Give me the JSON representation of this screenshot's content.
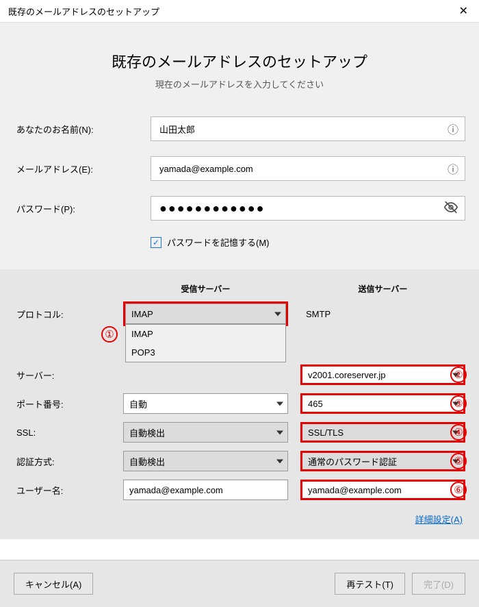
{
  "window": {
    "title": "既存のメールアドレスのセットアップ"
  },
  "header": {
    "heading": "既存のメールアドレスのセットアップ",
    "subheading": "現在のメールアドレスを入力してください"
  },
  "form": {
    "name_label": "あなたのお名前(N):",
    "name_value": "山田太郎",
    "email_label": "メールアドレス(E):",
    "email_value": "yamada@example.com",
    "password_label": "パスワード(P):",
    "password_mask": "●●●●●●●●●●●●",
    "remember_label": "パスワードを記憶する(M)"
  },
  "servers": {
    "incoming_header": "受信サーバー",
    "outgoing_header": "送信サーバー",
    "rows": {
      "protocol": {
        "label": "プロトコル:",
        "in": "IMAP",
        "out": "SMTP",
        "options": [
          "IMAP",
          "POP3"
        ]
      },
      "server": {
        "label": "サーバー:",
        "in": "",
        "out": "v2001.coreserver.jp"
      },
      "port": {
        "label": "ポート番号:",
        "in": "自動",
        "out": "465"
      },
      "ssl": {
        "label": "SSL:",
        "in": "自動検出",
        "out": "SSL/TLS"
      },
      "auth": {
        "label": "認証方式:",
        "in": "自動検出",
        "out": "通常のパスワード認証"
      },
      "user": {
        "label": "ユーザー名:",
        "in": "yamada@example.com",
        "out": "yamada@example.com"
      }
    }
  },
  "badges": {
    "b1": "①",
    "b2": "②",
    "b3": "③",
    "b4": "④",
    "b5": "⑤",
    "b6": "⑥"
  },
  "links": {
    "advanced": "詳細設定(A)"
  },
  "buttons": {
    "cancel": "キャンセル(A)",
    "retest": "再テスト(T)",
    "done": "完了(D)"
  }
}
